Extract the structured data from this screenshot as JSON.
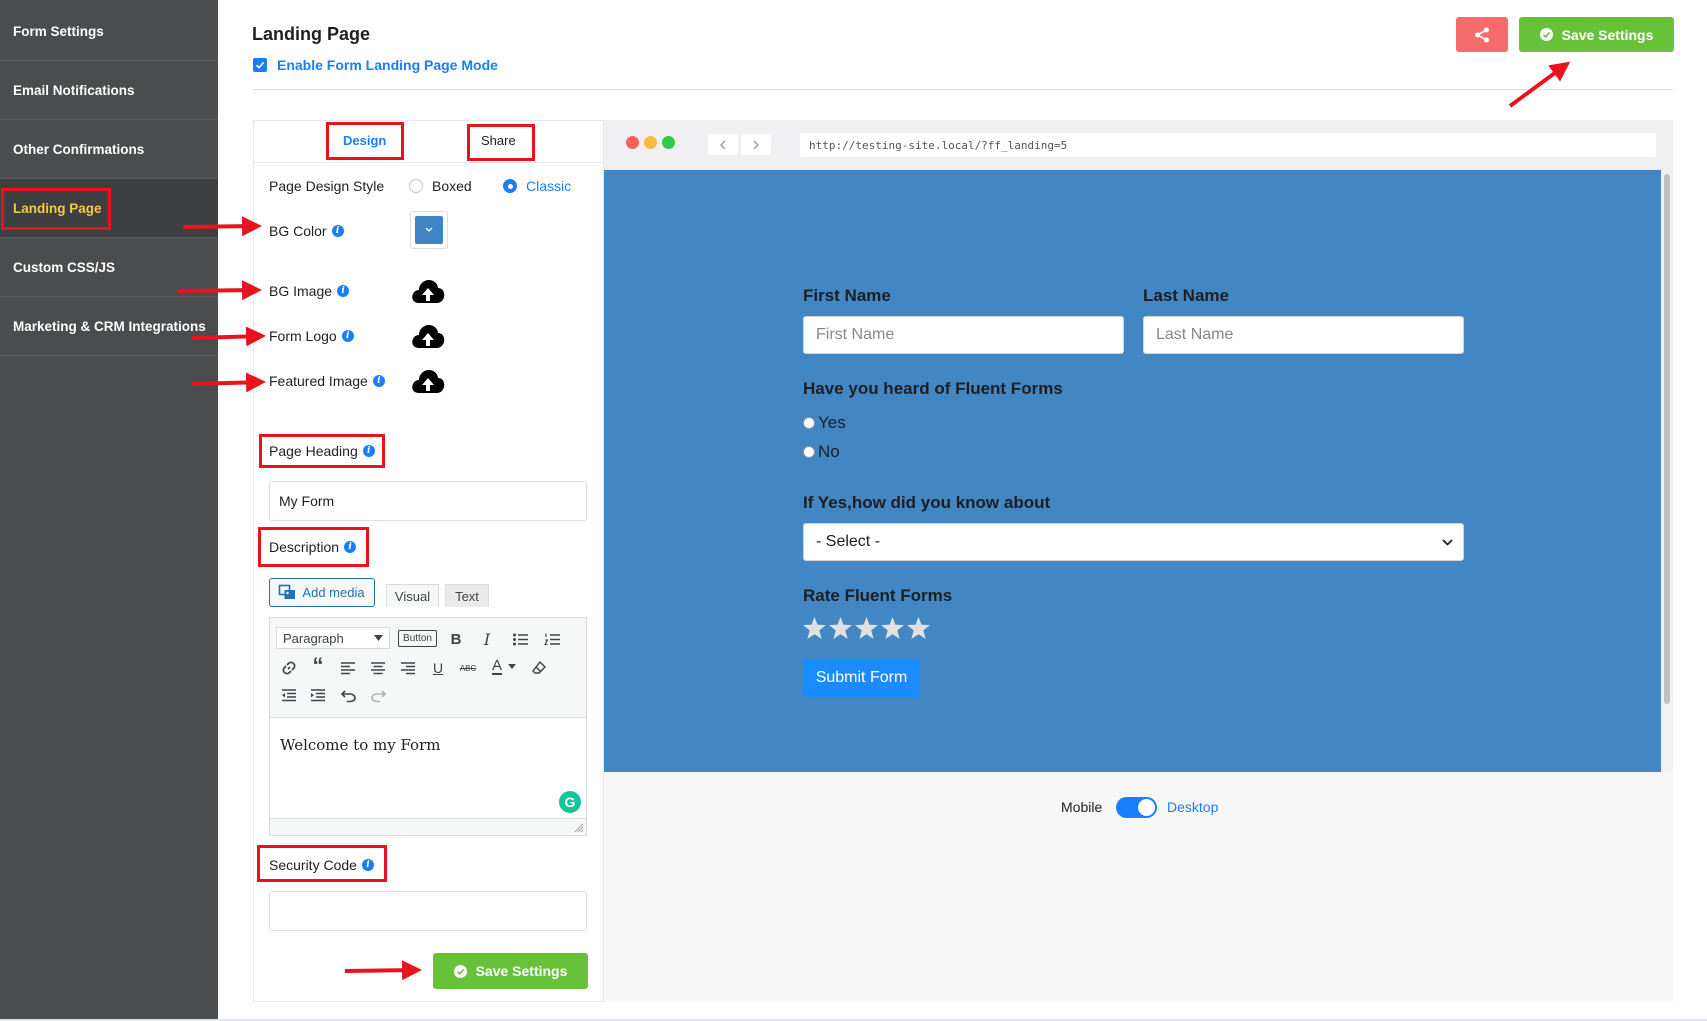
{
  "sidebar": {
    "items": [
      {
        "label": "Form Settings"
      },
      {
        "label": "Email Notifications"
      },
      {
        "label": "Other Confirmations"
      },
      {
        "label": "Landing Page",
        "active": true
      },
      {
        "label": "Custom CSS/JS"
      },
      {
        "label": "Marketing & CRM Integrations"
      }
    ]
  },
  "header": {
    "title": "Landing Page",
    "enable_label": "Enable Form Landing Page Mode",
    "enable_checked": true,
    "save_label": "Save Settings"
  },
  "panel": {
    "tabs": [
      {
        "label": "Design",
        "active": true
      },
      {
        "label": "Share"
      }
    ],
    "design_style_label": "Page Design Style",
    "design_style_options": [
      "Boxed",
      "Classic"
    ],
    "design_style_selected": "Classic",
    "bg_color_label": "BG Color",
    "bg_color_value": "#3f85c4",
    "bg_image_label": "BG Image",
    "form_logo_label": "Form Logo",
    "featured_image_label": "Featured Image",
    "page_heading_label": "Page Heading",
    "page_heading_value": "My Form",
    "description_label": "Description",
    "add_media_label": "Add media",
    "editor_tabs": [
      "Visual",
      "Text"
    ],
    "paragraph_select": "Paragraph",
    "button_label": "Button",
    "editor_content": "Welcome to my Form",
    "security_code_label": "Security Code",
    "security_code_value": "",
    "save_label": "Save Settings"
  },
  "preview": {
    "url": "http://testing-site.local/?ff_landing=5",
    "bg_color": "#4286c4",
    "first_name_label": "First Name",
    "first_name_placeholder": "First Name",
    "last_name_label": "Last Name",
    "last_name_placeholder": "Last Name",
    "heard_label": "Have you heard of Fluent Forms",
    "heard_options": [
      "Yes",
      "No"
    ],
    "how_label": "If Yes,how did you know about",
    "select_value": "- Select -",
    "rate_label": "Rate Fluent Forms",
    "stars": 5,
    "submit_label": "Submit Form",
    "toggle_left": "Mobile",
    "toggle_right": "Desktop"
  },
  "colors": {
    "accent": "#1a7efb",
    "green": "#67c23a",
    "share_red": "#f56c6c",
    "annotation_red": "#e8141d",
    "sidebar_bg": "#4b4c4d"
  }
}
